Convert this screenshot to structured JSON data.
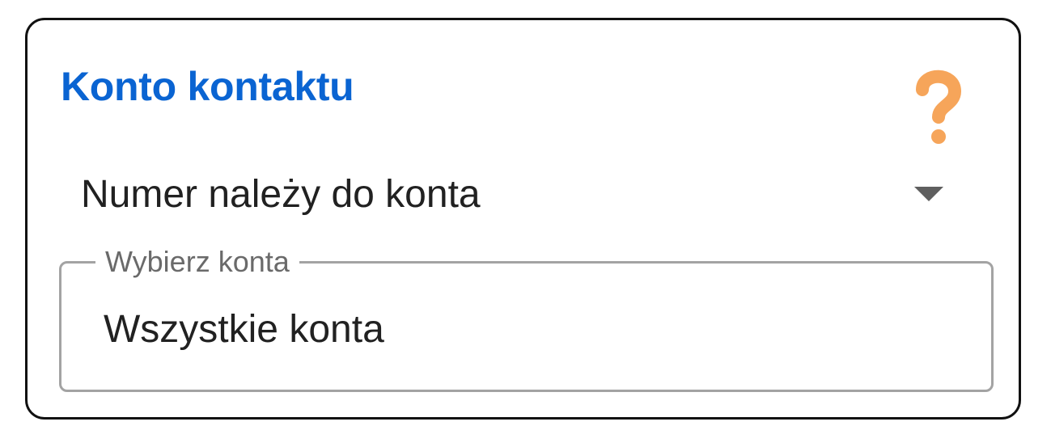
{
  "card": {
    "title": "Konto kontaktu",
    "help_icon": "question-mark-icon",
    "dropdown": {
      "selected": "Numer należy do konta",
      "arrow_icon": "dropdown-arrow-icon"
    },
    "account_field": {
      "label": "Wybierz konta",
      "value": "Wszystkie konta"
    }
  },
  "colors": {
    "title": "#0a64d2",
    "help_icon": "#f6a55a",
    "text": "#212121",
    "label": "#6a6a6a",
    "field_border": "#a3a3a3",
    "card_border": "#111111"
  }
}
